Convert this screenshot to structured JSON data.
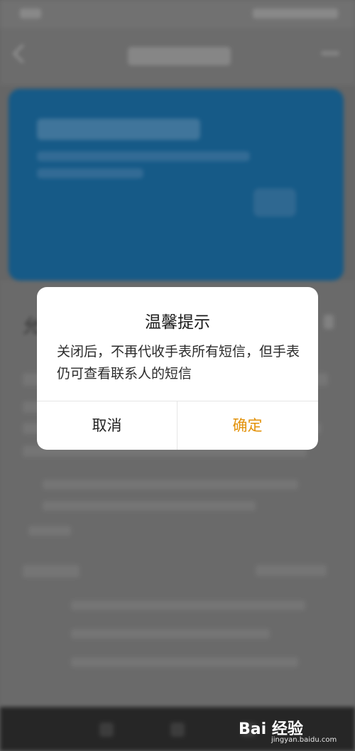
{
  "background": {
    "section_title": "允"
  },
  "dialog": {
    "title": "温馨提示",
    "message": "关闭后，不再代收手表所有短信，但手表仍可查看联系人的短信",
    "cancel_label": "取消",
    "confirm_label": "确定"
  },
  "colors": {
    "accent": "#e3920a",
    "card_blue": "#1b6ea5",
    "dialog_bg": "#ffffff"
  },
  "watermark": {
    "brand": "Bai 经验",
    "url": "jingyan.baidu.com"
  }
}
